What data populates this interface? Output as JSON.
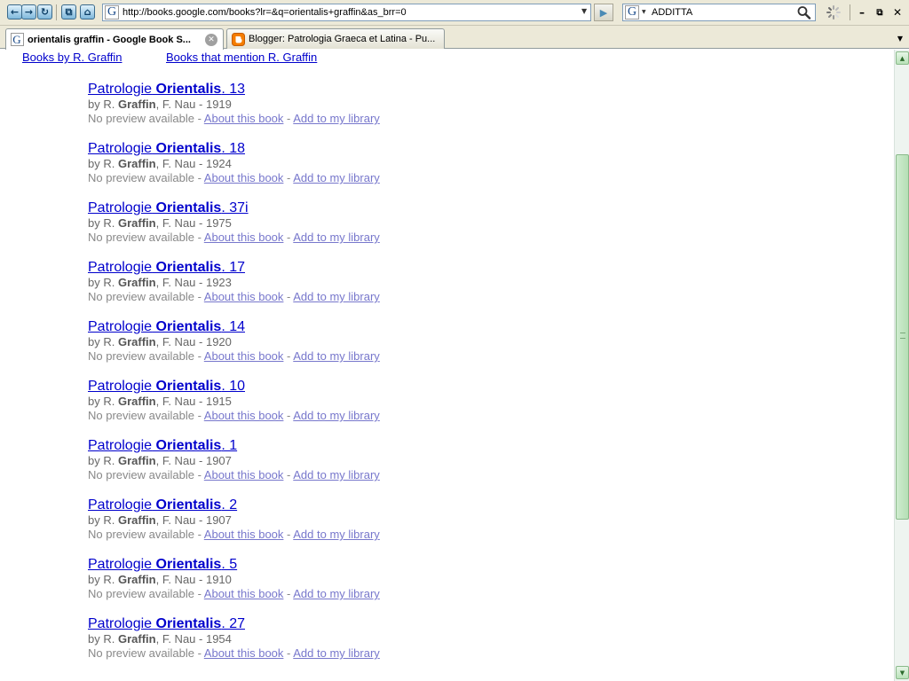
{
  "browser": {
    "address": {
      "url": "http://books.google.com/books?lr=&q=orientalis+graffin&as_brr=0",
      "favicon_letter": "G"
    },
    "search": {
      "value": "ADDITTA",
      "engine_letter": "G"
    },
    "tabs": [
      {
        "title": "orientalis graffin - Google Book S...",
        "active": true,
        "favicon": "google-icon"
      },
      {
        "title": "Blogger: Patrologia Graeca et Latina - Pu...",
        "active": false,
        "favicon": "blogger-icon"
      }
    ]
  },
  "page": {
    "top_links": {
      "books_by": "Books by R. Graffin",
      "books_mention": "Books that mention R. Graffin"
    },
    "result_labels": {
      "no_preview": "No preview available",
      "about": "About this book",
      "add": "Add to my library",
      "by": "by",
      "author_first": "R.",
      "author_last": "Graffin",
      "coauthor": ", F. Nau - ",
      "title_prefix": "Patrologie",
      "title_bold": "Orientalis",
      "separator": " - "
    },
    "results": [
      {
        "volume": ". 13",
        "year": "1919"
      },
      {
        "volume": ". 18",
        "year": "1924"
      },
      {
        "volume": ". 37i",
        "year": "1975"
      },
      {
        "volume": ". 17",
        "year": "1923"
      },
      {
        "volume": ". 14",
        "year": "1920"
      },
      {
        "volume": ". 10",
        "year": "1915"
      },
      {
        "volume": ". 1",
        "year": "1907"
      },
      {
        "volume": ". 2",
        "year": "1907"
      },
      {
        "volume": ". 5",
        "year": "1910"
      },
      {
        "volume": ". 27",
        "year": "1954"
      }
    ]
  },
  "colors": {
    "link": "#0000cc",
    "visited_link": "#7777cc",
    "meta_text": "#676767",
    "scrollbar_accent": "#b5dfb5"
  }
}
